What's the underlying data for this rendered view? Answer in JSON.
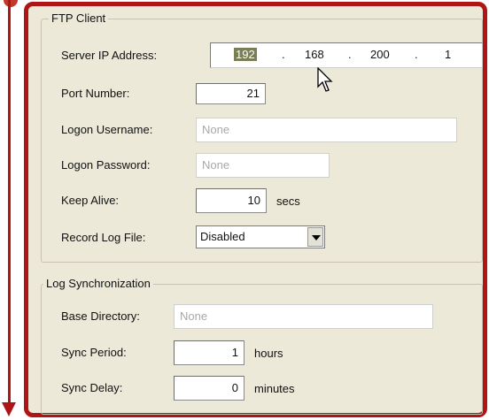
{
  "colors": {
    "frame": "#b01515",
    "panel": "#ece9d8",
    "ip_highlight": "#7a7e55"
  },
  "ftp_client": {
    "title": "FTP Client",
    "server_ip": {
      "label": "Server IP Address:",
      "octets": [
        "192",
        "168",
        "200",
        "1"
      ]
    },
    "port": {
      "label": "Port Number:",
      "value": "21"
    },
    "username": {
      "label": "Logon Username:",
      "placeholder": "None"
    },
    "password": {
      "label": "Logon Password:",
      "placeholder": "None"
    },
    "keep_alive": {
      "label": "Keep Alive:",
      "value": "10",
      "unit": "secs"
    },
    "record_log": {
      "label": "Record Log File:",
      "selected": "Disabled"
    }
  },
  "log_sync": {
    "title": "Log Synchronization",
    "base_dir": {
      "label": "Base Directory:",
      "placeholder": "None"
    },
    "sync_period": {
      "label": "Sync Period:",
      "value": "1",
      "unit": "hours"
    },
    "sync_delay": {
      "label": "Sync Delay:",
      "value": "0",
      "unit": "minutes"
    }
  },
  "icons": {
    "cursor": "mouse-pointer-icon",
    "arrow": "down-arrow-icon"
  }
}
